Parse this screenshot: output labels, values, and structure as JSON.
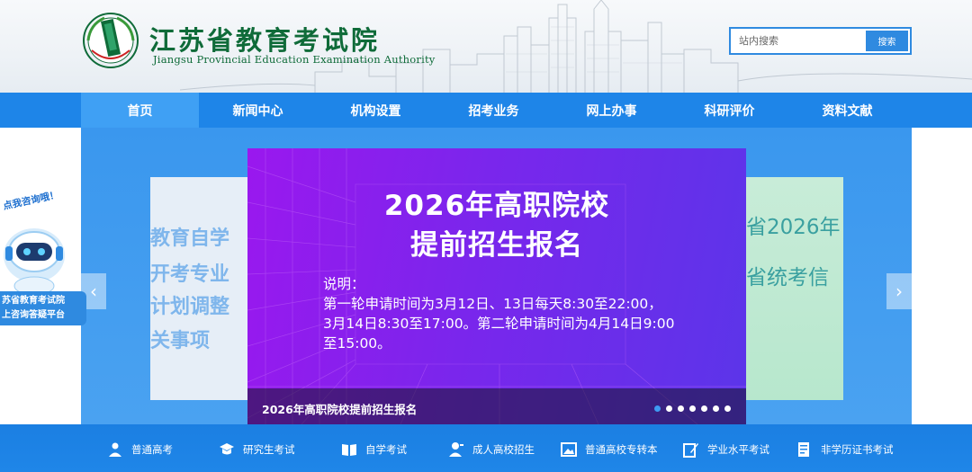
{
  "header": {
    "title_cn": "江苏省教育考试院",
    "title_en": "Jiangsu Provincial Education Examination Authority",
    "search": {
      "placeholder": "站内搜索",
      "button_label": "搜索"
    }
  },
  "nav": {
    "items": [
      {
        "label": "首页",
        "active": true
      },
      {
        "label": "新闻中心"
      },
      {
        "label": "机构设置"
      },
      {
        "label": "招考业务"
      },
      {
        "label": "网上办事"
      },
      {
        "label": "科研评价"
      },
      {
        "label": "资料文献"
      }
    ]
  },
  "banner": {
    "title_line1": "2026年高职院校",
    "title_line2": "提前招生报名",
    "desc_label": "说明：",
    "desc_line1": "第一轮申请时间为3月12日、13日每天8:30至22:00，",
    "desc_line2": "3月14日8:30至17:00。第二轮申请时间为4月14日9:00",
    "desc_line3": "至15:00。",
    "caption": "2026年高职院校提前招生报名",
    "dot_count": 7,
    "active_dot": 0,
    "left_slide_lines": [
      "教育自学",
      "开考专业",
      "计划调整",
      "关事项"
    ],
    "right_slide_lines": [
      "省2026年",
      "省统考信"
    ],
    "colors": {
      "primary": "#1e85e8",
      "slide_purple": "#8a1eee"
    }
  },
  "consult": {
    "tag": "点我咨询哦！",
    "line1": "苏省教育考试院",
    "line2": "上咨询答疑平台"
  },
  "categories": [
    {
      "label": "普通高考",
      "icon": "graduate-icon"
    },
    {
      "label": "研究生考试",
      "icon": "cap-icon"
    },
    {
      "label": "自学考试",
      "icon": "book-icon"
    },
    {
      "label": "成人高校招生",
      "icon": "user-icon"
    },
    {
      "label": "普通高校专转本",
      "icon": "image-icon"
    },
    {
      "label": "学业水平考试",
      "icon": "pen-icon"
    },
    {
      "label": "非学历证书考试",
      "icon": "certificate-icon"
    }
  ]
}
